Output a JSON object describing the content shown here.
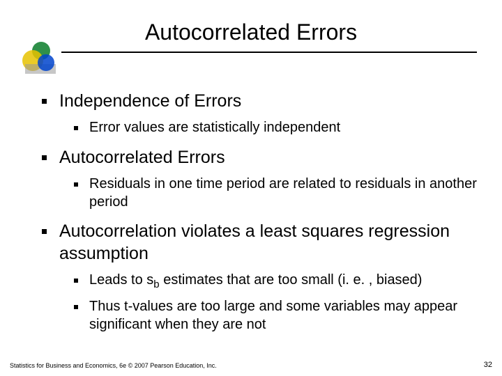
{
  "title": "Autocorrelated Errors",
  "bullets": [
    {
      "text": "Independence of Errors",
      "sub": [
        {
          "text": "Error values are statistically independent"
        }
      ]
    },
    {
      "text": "Autocorrelated Errors",
      "sub": [
        {
          "text": "Residuals in one time period are related to residuals in another period"
        }
      ]
    },
    {
      "text": "Autocorrelation violates a least squares regression assumption",
      "sub": [
        {
          "pre": "Leads to  s",
          "subscript": "b",
          "post": "  estimates that are too small (i. e. , biased)"
        },
        {
          "text": "Thus t-values are too large and some variables may appear significant when they are not"
        }
      ]
    }
  ],
  "footer_left": "Statistics for Business and Economics, 6e © 2007 Pearson Education, Inc.",
  "footer_right": "32"
}
